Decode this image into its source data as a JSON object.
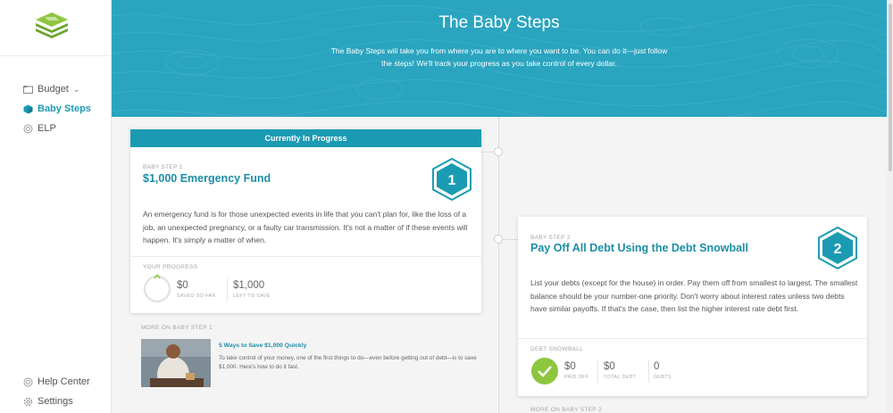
{
  "sidebar": {
    "items": [
      {
        "label": "Budget",
        "icon": "folder-icon"
      },
      {
        "label": "Baby Steps",
        "icon": "cube-icon"
      },
      {
        "label": "ELP",
        "icon": "target-icon"
      }
    ],
    "bottom": [
      {
        "label": "Help Center",
        "icon": "help-icon"
      },
      {
        "label": "Settings",
        "icon": "gear-icon"
      }
    ]
  },
  "hero": {
    "title": "The Baby Steps",
    "subtitle": "The Baby Steps will take you from where you are to where you want to be. You can do it—just follow the steps! We'll track your progress as you take control of every dollar."
  },
  "step1": {
    "header": "Currently In Progress",
    "label": "BABY STEP 1",
    "title": "$1,000 Emergency Fund",
    "number": "1",
    "description": "An emergency fund is for those unexpected events in life that you can't plan for, like the loss of a job, an unexpected pregnancy, or a faulty car transmission. It's not a matter of if these events will happen. It's simply a matter of when.",
    "progress_label": "YOUR PROGRESS",
    "saved_value": "$0",
    "saved_label": "SAVED SO FAR",
    "left_value": "$1,000",
    "left_label": "LEFT TO SAVE",
    "progress_fraction": 0
  },
  "more1": {
    "label": "MORE ON BABY STEP 1",
    "article_title": "5 Ways to Save $1,000 Quickly",
    "article_desc": "To take control of your money, one of the first things to do—even before getting out of debt—is to save $1,000. Here's how to do it fast."
  },
  "step2": {
    "label": "BABY STEP 2",
    "title": "Pay Off All Debt Using the Debt Snowball",
    "number": "2",
    "description": "List your debts (except for the house) in order. Pay them off from smallest to largest. The smallest balance should be your number-one priority. Don't worry about interest rates unless two debts have similar payoffs. If that's the case, then list the higher interest rate debt first.",
    "section_label": "DEBT SNOWBALL",
    "paid_value": "$0",
    "paid_label": "PAID OFF",
    "total_value": "$0",
    "total_label": "TOTAL DEBT",
    "debts_value": "0",
    "debts_label": "DEBTS"
  },
  "more2": {
    "label": "MORE ON BABY STEP 2"
  },
  "colors": {
    "accent": "#1b9bb3",
    "hero": "#2aa4bf",
    "green": "#8dc63f"
  }
}
